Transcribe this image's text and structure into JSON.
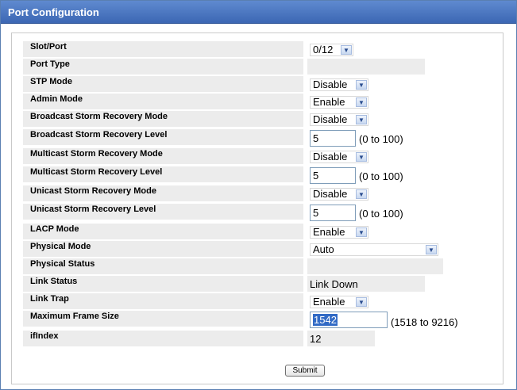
{
  "window": {
    "title": "Port Configuration"
  },
  "fields": [
    {
      "label": "Slot/Port",
      "kind": "select",
      "value": "0/12"
    },
    {
      "label": "Port Type",
      "kind": "readonly",
      "value": ""
    },
    {
      "label": "STP Mode",
      "kind": "select",
      "value": "Disable"
    },
    {
      "label": "Admin Mode",
      "kind": "select",
      "value": "Enable"
    },
    {
      "label": "Broadcast Storm Recovery Mode",
      "kind": "select",
      "value": "Disable"
    },
    {
      "label": "Broadcast Storm Recovery Level",
      "kind": "input",
      "value": "5",
      "range": "(0 to 100)"
    },
    {
      "label": "Multicast Storm Recovery Mode",
      "kind": "select",
      "value": "Disable"
    },
    {
      "label": "Multicast Storm Recovery Level",
      "kind": "input",
      "value": "5",
      "range": "(0 to 100)"
    },
    {
      "label": "Unicast Storm Recovery Mode",
      "kind": "select",
      "value": "Disable"
    },
    {
      "label": "Unicast Storm Recovery Level",
      "kind": "input",
      "value": "5",
      "range": "(0 to 100)"
    },
    {
      "label": "LACP Mode",
      "kind": "select",
      "value": "Enable"
    },
    {
      "label": "Physical Mode",
      "kind": "select",
      "value": "Auto"
    },
    {
      "label": "Physical Status",
      "kind": "readonly",
      "value": ""
    },
    {
      "label": "Link Status",
      "kind": "readonly",
      "value": "Link Down"
    },
    {
      "label": "Link Trap",
      "kind": "select",
      "value": "Enable"
    },
    {
      "label": "Maximum Frame Size",
      "kind": "input",
      "value": "1542",
      "range": "(1518 to 9216)"
    },
    {
      "label": "ifIndex",
      "kind": "readonly",
      "value": "12"
    }
  ],
  "buttons": {
    "submit": "Submit"
  },
  "colors": {
    "title_bar": "#3c67b4",
    "label_bg": "#ececec",
    "selected_text_bg": "#316ac5"
  },
  "icons": {
    "dropdown": "chevron-down-icon"
  }
}
